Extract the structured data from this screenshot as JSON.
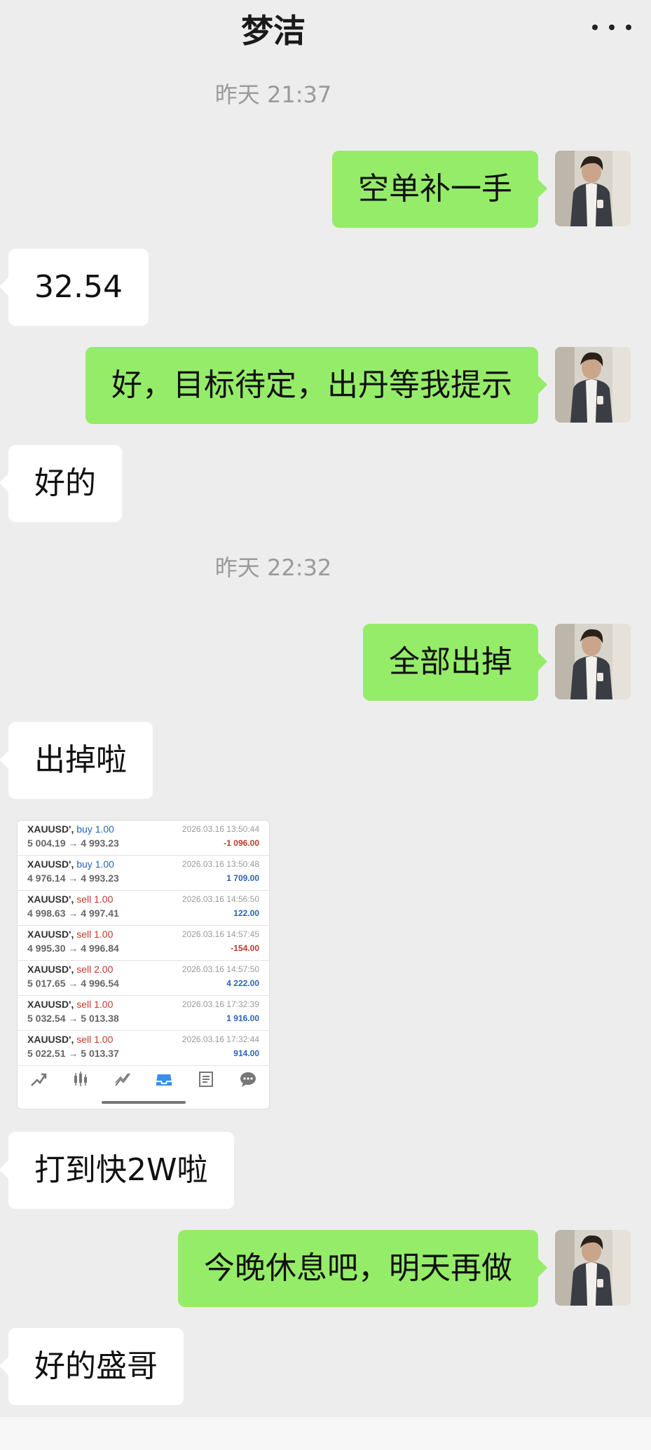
{
  "header": {
    "title": "梦洁",
    "more_icon": "more-icon"
  },
  "colors": {
    "background": "#ededed",
    "my_bubble": "#95ec69",
    "their_bubble": "#ffffff",
    "buy": "#2a63b8",
    "sell": "#c0392b"
  },
  "messages": {
    "time1": "昨天 21:37",
    "m1": "空单补一手",
    "m2": "32.54",
    "m3": "好，目标待定，出丹等我提示",
    "m4": "好的",
    "time2": "昨天 22:32",
    "m5": "全部出掉",
    "m6": "出掉啦",
    "m7": "打到快2W啦",
    "m8": "今晚休息吧，明天再做",
    "m9": "好的盛哥"
  },
  "trades": [
    {
      "symbol": "XAUUSD',",
      "side": "buy 1.00",
      "prices": "5 004.19 → 4 993.23",
      "datetime": "2026.03.16 13:50:44",
      "profit": "-1 096.00"
    },
    {
      "symbol": "XAUUSD',",
      "side": "buy 1.00",
      "prices": "4 976.14 → 4 993.23",
      "datetime": "2026.03.16 13:50:48",
      "profit": "1 709.00"
    },
    {
      "symbol": "XAUUSD',",
      "side": "sell 1.00",
      "prices": "4 998.63 → 4 997.41",
      "datetime": "2026.03.16 14:56:50",
      "profit": "122.00"
    },
    {
      "symbol": "XAUUSD',",
      "side": "sell 1.00",
      "prices": "4 995.30 → 4 996.84",
      "datetime": "2026.03.16 14:57:45",
      "profit": "-154.00"
    },
    {
      "symbol": "XAUUSD',",
      "side": "sell 2.00",
      "prices": "5 017.65 → 4 996.54",
      "datetime": "2026.03.16 14:57:50",
      "profit": "4 222.00"
    },
    {
      "symbol": "XAUUSD',",
      "side": "sell 1.00",
      "prices": "5 032.54 → 5 013.38",
      "datetime": "2026.03.16 17:32:39",
      "profit": "1 916.00"
    },
    {
      "symbol": "XAUUSD',",
      "side": "sell 1.00",
      "prices": "5 022.51 → 5 013.37",
      "datetime": "2026.03.16 17:32:44",
      "profit": "914.00"
    }
  ],
  "toolbar_icons": [
    "trade-icon",
    "chart-icon",
    "history-icon",
    "inbox-icon",
    "news-icon",
    "chat-icon"
  ]
}
